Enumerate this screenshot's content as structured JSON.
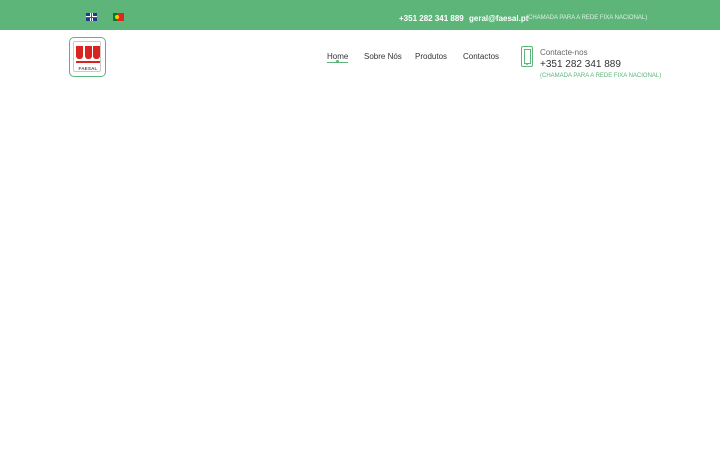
{
  "topbar": {
    "languages": [
      {
        "name": "english-flag-icon"
      },
      {
        "name": "portuguese-flag-icon"
      }
    ],
    "phone": "+351 282 341 889",
    "email": "geral@faesal.pt",
    "note": "(CHAMADA PARA A REDE FIXA NACIONAL)",
    "bg_color": "#5db57a"
  },
  "logo": {
    "text": "FAESAL",
    "accent_color": "#d8231f"
  },
  "nav": {
    "items": [
      {
        "label": "Home",
        "active": true
      },
      {
        "label": "Sobre Nós",
        "active": false
      },
      {
        "label": "Produtos",
        "active": false
      },
      {
        "label": "Contactos",
        "active": false
      }
    ]
  },
  "contact": {
    "icon": "mobile-phone-icon",
    "label": "Contacte-nos",
    "phone": "+351 282 341 889",
    "note": "(CHAMADA PARA A REDE FIXA NACIONAL)"
  }
}
